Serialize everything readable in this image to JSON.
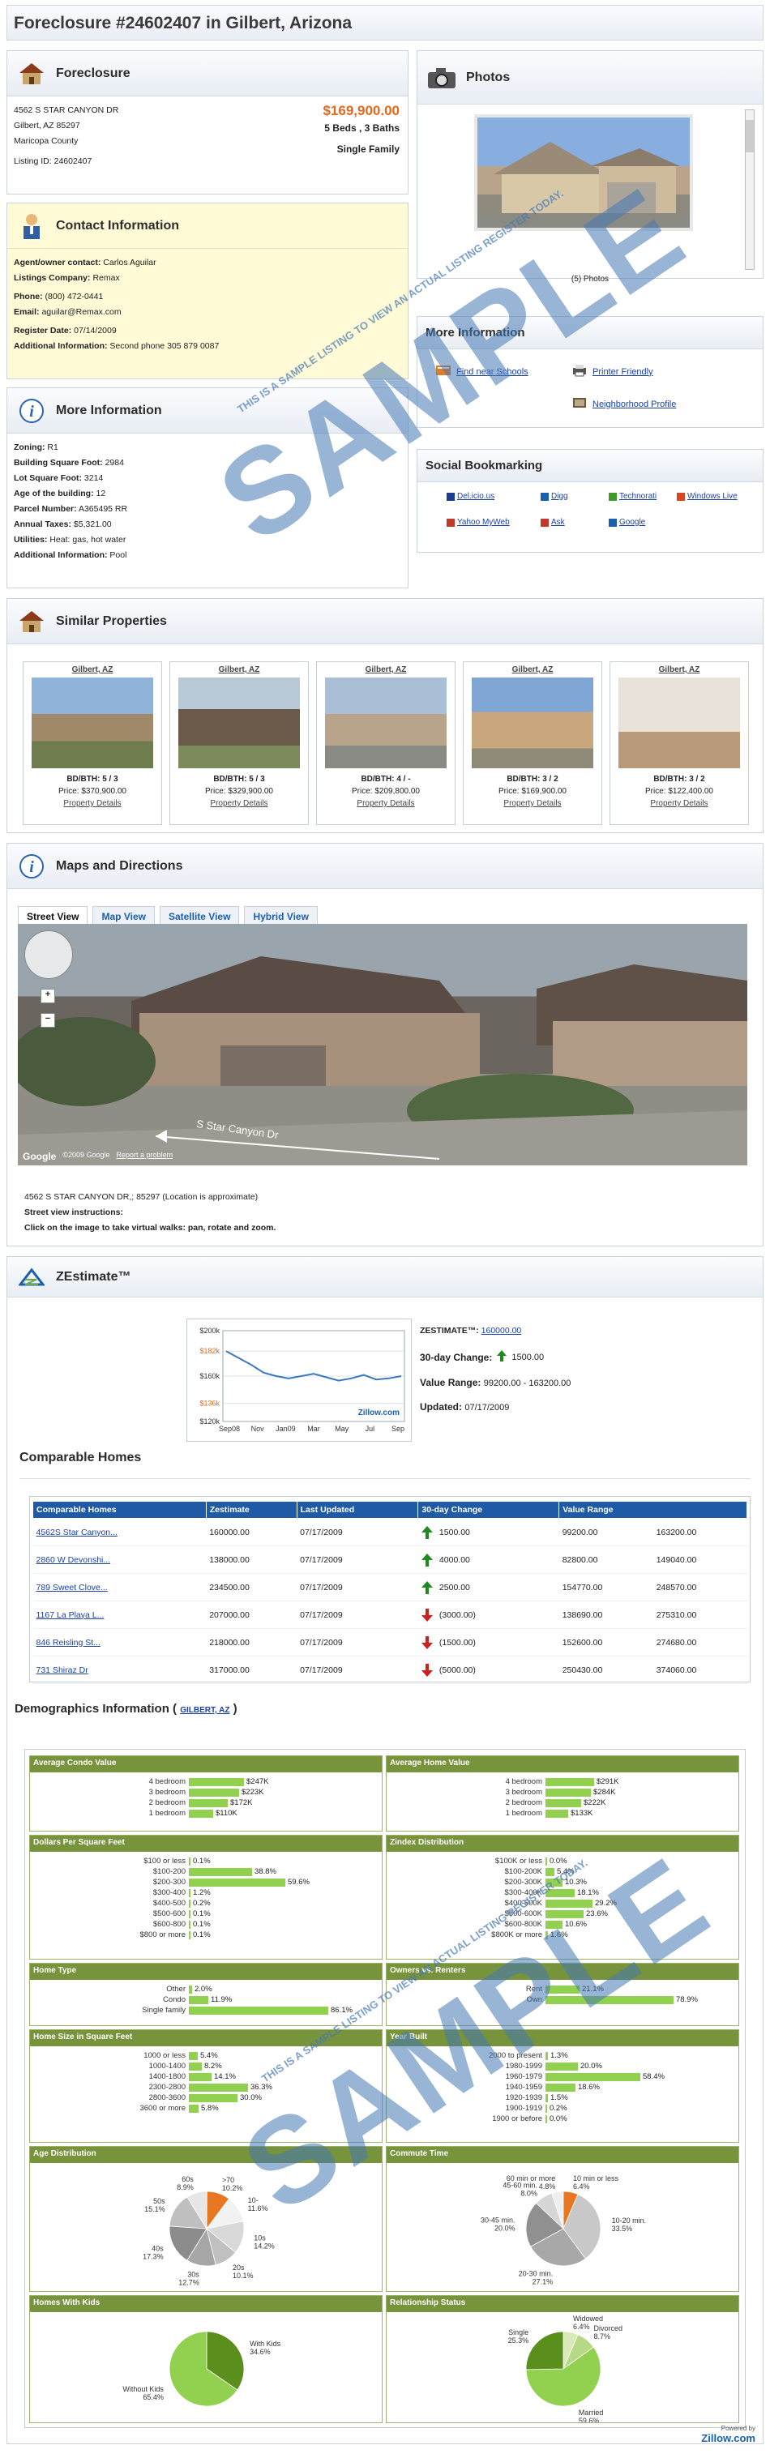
{
  "header": {
    "title": "Foreclosure #24602407 in Gilbert, Arizona"
  },
  "listing": {
    "panel_title": "Foreclosure",
    "address": "4562 S STAR CANYON DR",
    "city_line": "Gilbert, AZ 85297",
    "county": "Maricopa County",
    "listing_id": "Listing ID: 24602407",
    "price": "$169,900.00",
    "beds_baths": "5 Beds , 3 Baths",
    "type": "Single Family"
  },
  "contact": {
    "panel_title": "Contact Information",
    "agent_label": "Agent/owner contact:",
    "agent": "Carlos Aguilar",
    "company_label": "Listings Company:",
    "company": "Remax",
    "phone_label": "Phone:",
    "phone": "(800) 472-0441",
    "email_label": "Email:",
    "email": "aguilar@Remax.com",
    "register_label": "Register Date:",
    "register": "07/14/2009",
    "add_label": "Additional Information:",
    "add": "Second phone 305 879 0087"
  },
  "more": {
    "panel_title": "More Information",
    "rows": [
      {
        "k": "Zoning:",
        "v": "R1"
      },
      {
        "k": "Building Square Foot:",
        "v": "2984"
      },
      {
        "k": "Lot Square Foot:",
        "v": "3214"
      },
      {
        "k": "Age of the building:",
        "v": "12"
      },
      {
        "k": "Parcel Number:",
        "v": "A365495 RR"
      },
      {
        "k": "Annual Taxes:",
        "v": "$5,321.00"
      },
      {
        "k": "Utilities:",
        "v": "Heat: gas, hot water"
      },
      {
        "k": "Additional Information:",
        "v": "Pool"
      }
    ]
  },
  "photos": {
    "panel_title": "Photos",
    "caption": "(5) Photos"
  },
  "moreinfo": {
    "panel_title": "More Information",
    "schools": "Find near Schools",
    "printer": "Printer Friendly",
    "neighborhood": "Neighborhood Profile"
  },
  "social": {
    "panel_title": "Social Bookmarking",
    "items": [
      "Del.icio.us",
      "Digg",
      "Technorati",
      "Windows Live",
      "Yahoo MyWeb",
      "Ask",
      "Google"
    ]
  },
  "similar": {
    "panel_title": "Similar Properties",
    "cards": [
      {
        "city": "Gilbert, AZ",
        "bdbth": "BD/BTH: 5 / 3",
        "price": "Price: $370,900.00",
        "link": "Property Details"
      },
      {
        "city": "Gilbert, AZ",
        "bdbth": "BD/BTH: 5 / 3",
        "price": "Price: $329,900.00",
        "link": "Property Details"
      },
      {
        "city": "Gilbert, AZ",
        "bdbth": "BD/BTH: 4 / -",
        "price": "Price: $209,800.00",
        "link": "Property Details"
      },
      {
        "city": "Gilbert, AZ",
        "bdbth": "BD/BTH: 3 / 2",
        "price": "Price: $169,900.00",
        "link": "Property Details"
      },
      {
        "city": "Gilbert, AZ",
        "bdbth": "BD/BTH: 3 / 2",
        "price": "Price: $122,400.00",
        "link": "Property Details"
      }
    ]
  },
  "maps": {
    "panel_title": "Maps and Directions",
    "tabs": [
      "Street View",
      "Map View",
      "Satellite View",
      "Hybrid View"
    ],
    "street_label": "S Star Canyon Dr",
    "copyright": "©2009 Google",
    "report": "Report a problem",
    "google": "Google",
    "address_note": "4562 S STAR CANYON DR,; 85297 (Location is approximate)",
    "instr_title": "Street view instructions:",
    "instr": "Click on the image to take virtual walks: pan, rotate and zoom."
  },
  "zestimate": {
    "panel_title": "ZEstimate™",
    "label": "ZESTIMATE™:",
    "value": "160000.00",
    "change_label": "30-day Change:",
    "change": "1500.00",
    "range_label": "Value Range:",
    "range": "99200.00 - 163200.00",
    "updated_label": "Updated:",
    "updated": "07/17/2009",
    "chart_brand": "Zillow.com"
  },
  "chart_data": {
    "type": "line",
    "x": [
      "Sep08",
      "Nov",
      "Jan09",
      "Mar",
      "May",
      "Jul",
      "Sep"
    ],
    "y_ticks": [
      "$200k",
      "$182k",
      "$160k",
      "$136k",
      "$120k"
    ],
    "ylim": [
      120,
      200
    ],
    "series": [
      {
        "values": [
          182,
          176,
          170,
          163,
          160,
          158,
          160,
          162,
          159,
          156,
          158,
          161,
          157,
          158,
          160
        ]
      }
    ]
  },
  "comparable": {
    "title": "Comparable Homes",
    "headers": [
      "Comparable Homes",
      "Zestimate",
      "Last Updated",
      "30-day Change",
      "Value Range"
    ],
    "rows": [
      {
        "name": "4562S Star Canyon...",
        "z": "160000.00",
        "upd": "07/17/2009",
        "dir": "up",
        "chg": "1500.00",
        "lo": "99200.00",
        "hi": "163200.00"
      },
      {
        "name": "2860 W Devonshi...",
        "z": "138000.00",
        "upd": "07/17/2009",
        "dir": "up",
        "chg": "4000.00",
        "lo": "82800.00",
        "hi": "149040.00"
      },
      {
        "name": "789 Sweet Clove...",
        "z": "234500.00",
        "upd": "07/17/2009",
        "dir": "up",
        "chg": "2500.00",
        "lo": "154770.00",
        "hi": "248570.00"
      },
      {
        "name": "1167 La Playa L...",
        "z": "207000.00",
        "upd": "07/17/2009",
        "dir": "down",
        "chg": "(3000.00)",
        "lo": "138690.00",
        "hi": "275310.00"
      },
      {
        "name": "846 Reisling St...",
        "z": "218000.00",
        "upd": "07/17/2009",
        "dir": "down",
        "chg": "(1500.00)",
        "lo": "152600.00",
        "hi": "274680.00"
      },
      {
        "name": "731 Shiraz Dr",
        "z": "317000.00",
        "upd": "07/17/2009",
        "dir": "down",
        "chg": "(5000.00)",
        "lo": "250430.00",
        "hi": "374060.00"
      }
    ]
  },
  "demographics": {
    "title": "Demographics Information (",
    "link": "GILBERT, AZ",
    "close": ")",
    "condo": {
      "title": "Average Condo Value",
      "rows": [
        {
          "l": "4 bedroom",
          "v": "$247K",
          "p": 0.34
        },
        {
          "l": "3 bedroom",
          "v": "$223K",
          "p": 0.31
        },
        {
          "l": "2 bedroom",
          "v": "$172K",
          "p": 0.24
        },
        {
          "l": "1 bedroom",
          "v": "$110K",
          "p": 0.15
        }
      ]
    },
    "home": {
      "title": "Average Home Value",
      "rows": [
        {
          "l": "4 bedroom",
          "v": "$291K",
          "p": 0.3
        },
        {
          "l": "3 bedroom",
          "v": "$284K",
          "p": 0.28
        },
        {
          "l": "2 bedroom",
          "v": "$222K",
          "p": 0.22
        },
        {
          "l": "1 bedroom",
          "v": "$133K",
          "p": 0.14
        }
      ]
    },
    "dpsf": {
      "title": "Dollars Per Square Feet",
      "rows": [
        {
          "l": "$100 or less",
          "v": "0.1%",
          "p": 0.003
        },
        {
          "l": "$100-200",
          "v": "38.8%",
          "p": 0.388
        },
        {
          "l": "$200-300",
          "v": "59.6%",
          "p": 0.596
        },
        {
          "l": "$300-400",
          "v": "1.2%",
          "p": 0.012
        },
        {
          "l": "$400-500",
          "v": "0.2%",
          "p": 0.004
        },
        {
          "l": "$500-600",
          "v": "0.1%",
          "p": 0.003
        },
        {
          "l": "$600-800",
          "v": "0.1%",
          "p": 0.003
        },
        {
          "l": "$800 or more",
          "v": "0.1%",
          "p": 0.003
        }
      ]
    },
    "zindex": {
      "title": "Zindex Distribution",
      "rows": [
        {
          "l": "$100K or less",
          "v": "0.0%",
          "p": 0
        },
        {
          "l": "$100-200K",
          "v": "5.4%",
          "p": 0.054
        },
        {
          "l": "$200-300K",
          "v": "10.3%",
          "p": 0.103
        },
        {
          "l": "$300-400K",
          "v": "18.1%",
          "p": 0.181
        },
        {
          "l": "$400-500K",
          "v": "29.2%",
          "p": 0.292
        },
        {
          "l": "$500-600K",
          "v": "23.6%",
          "p": 0.236
        },
        {
          "l": "$600-800K",
          "v": "10.6%",
          "p": 0.106
        },
        {
          "l": "$800K or more",
          "v": "1.6%",
          "p": 0.016
        }
      ]
    },
    "hometype": {
      "title": "Home Type",
      "rows": [
        {
          "l": "Other",
          "v": "2.0%",
          "p": 0.02
        },
        {
          "l": "Condo",
          "v": "11.9%",
          "p": 0.119
        },
        {
          "l": "Single family",
          "v": "86.1%",
          "p": 0.861
        }
      ]
    },
    "owners": {
      "title": "Owners vs. Renters",
      "rows": [
        {
          "l": "Rent",
          "v": "21.1%",
          "p": 0.211
        },
        {
          "l": "Own",
          "v": "78.9%",
          "p": 0.789
        }
      ]
    },
    "homesize": {
      "title": "Home Size in Square Feet",
      "rows": [
        {
          "l": "1000 or less",
          "v": "5.4%",
          "p": 0.054
        },
        {
          "l": "1000-1400",
          "v": "8.2%",
          "p": 0.082
        },
        {
          "l": "1400-1800",
          "v": "14.1%",
          "p": 0.141
        },
        {
          "l": "2300-2800",
          "v": "36.3%",
          "p": 0.363
        },
        {
          "l": "2800-3600",
          "v": "30.0%",
          "p": 0.3
        },
        {
          "l": "3600 or more",
          "v": "5.8%",
          "p": 0.058
        }
      ]
    },
    "yearbuilt": {
      "title": "Year Built",
      "rows": [
        {
          "l": "2000 to present",
          "v": "1.3%",
          "p": 0.013
        },
        {
          "l": "1980-1999",
          "v": "20.0%",
          "p": 0.2
        },
        {
          "l": "1960-1979",
          "v": "58.4%",
          "p": 0.584
        },
        {
          "l": "1940-1959",
          "v": "18.6%",
          "p": 0.186
        },
        {
          "l": "1920-1939",
          "v": "1.5%",
          "p": 0.015
        },
        {
          "l": "1900-1919",
          "v": "0.2%",
          "p": 0.002
        },
        {
          "l": "1900 or before",
          "v": "0.0%",
          "p": 0
        }
      ]
    },
    "age": {
      "title": "Age Distribution",
      "slices": [
        {
          "l": ">70",
          "v": "10.2%",
          "p": 0.102
        },
        {
          "l": "10-",
          "v": "11.6%",
          "p": 0.116
        },
        {
          "l": "10s",
          "v": "14.2%",
          "p": 0.142
        },
        {
          "l": "20s",
          "v": "10.1%",
          "p": 0.101
        },
        {
          "l": "30s",
          "v": "12.7%",
          "p": 0.127
        },
        {
          "l": "40s",
          "v": "17.3%",
          "p": 0.173
        },
        {
          "l": "50s",
          "v": "15.1%",
          "p": 0.151
        },
        {
          "l": "60s",
          "v": "8.9%",
          "p": 0.089
        }
      ]
    },
    "commute": {
      "title": "Commute Time",
      "slices": [
        {
          "l": "10 min or less",
          "v": "6.4%",
          "p": 0.064
        },
        {
          "l": "10-20 min.",
          "v": "33.5%",
          "p": 0.335
        },
        {
          "l": "20-30 min.",
          "v": "27.1%",
          "p": 0.271
        },
        {
          "l": "30-45 min.",
          "v": "20.0%",
          "p": 0.2
        },
        {
          "l": "45-60 min.",
          "v": "8.0%",
          "p": 0.08
        },
        {
          "l": "60 min or more",
          "v": "4.8%",
          "p": 0.048
        }
      ]
    },
    "kids": {
      "title": "Homes With Kids",
      "slices": [
        {
          "l": "With Kids",
          "v": "34.6%",
          "p": 0.346
        },
        {
          "l": "Without Kids",
          "v": "65.4%",
          "p": 0.654
        }
      ]
    },
    "relationship": {
      "title": "Relationship Status",
      "slices": [
        {
          "l": "Widowed",
          "v": "6.4%",
          "p": 0.064
        },
        {
          "l": "Divorced",
          "v": "8.7%",
          "p": 0.087
        },
        {
          "l": "Married",
          "v": "59.6%",
          "p": 0.596
        },
        {
          "l": "Single",
          "v": "25.3%",
          "p": 0.253
        }
      ]
    }
  },
  "footer": {
    "powered": "Powered by",
    "brand": "Zillow.com"
  },
  "watermark": {
    "big": "SAMPLE",
    "small": "THIS IS A SAMPLE LISTING TO VIEW AN ACTUAL LISTING REGISTER TODAY."
  }
}
